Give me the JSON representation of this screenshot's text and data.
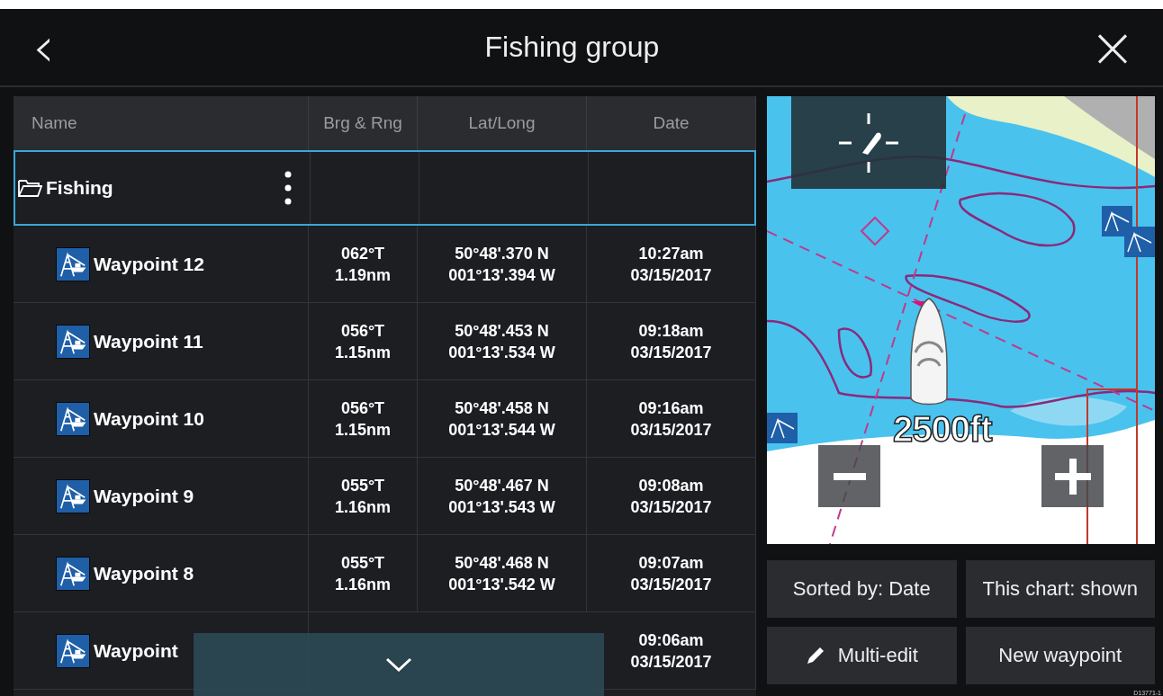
{
  "header": {
    "back_icon": "‹",
    "title": "Fishing group",
    "close_icon": "×"
  },
  "table": {
    "columns": [
      "Name",
      "Brg & Rng",
      "Lat/Long",
      "Date"
    ],
    "rows": [
      {
        "kind": "folder",
        "name": "Fishing",
        "selected": true
      },
      {
        "kind": "waypoint",
        "name": "Waypoint 12",
        "bearing": "062°T",
        "range": "1.19nm",
        "lat": "50°48'.370 N",
        "long": "001°13'.394 W",
        "time": "10:27am",
        "date": "03/15/2017",
        "selected": false
      },
      {
        "kind": "waypoint",
        "name": "Waypoint 11",
        "bearing": "056°T",
        "range": "1.15nm",
        "lat": "50°48'.453 N",
        "long": "001°13'.534 W",
        "time": "09:18am",
        "date": "03/15/2017",
        "selected": false
      },
      {
        "kind": "waypoint",
        "name": "Waypoint 10",
        "bearing": "056°T",
        "range": "1.15nm",
        "lat": "50°48'.458 N",
        "long": "001°13'.544 W",
        "time": "09:16am",
        "date": "03/15/2017",
        "selected": false
      },
      {
        "kind": "waypoint",
        "name": "Waypoint 9",
        "bearing": "055°T",
        "range": "1.16nm",
        "lat": "50°48'.467 N",
        "long": "001°13'.543 W",
        "time": "09:08am",
        "date": "03/15/2017",
        "selected": false
      },
      {
        "kind": "waypoint",
        "name": "Waypoint 8",
        "bearing": "055°T",
        "range": "1.16nm",
        "lat": "50°48'.468 N",
        "long": "001°13'.542 W",
        "time": "09:07am",
        "date": "03/15/2017",
        "selected": false
      },
      {
        "kind": "waypoint",
        "name": "Waypoint",
        "time": "09:06am",
        "date": "03/15/2017",
        "selected": false
      }
    ]
  },
  "map": {
    "scale": "2500ft"
  },
  "buttons": [
    {
      "kind": "plain",
      "label": "Sorted by: Date"
    },
    {
      "kind": "plain",
      "label": "This chart: shown"
    },
    {
      "kind": "edit",
      "label": "Multi-edit"
    },
    {
      "kind": "plain",
      "label": "New waypoint"
    }
  ],
  "figure_code": "D13771-1"
}
